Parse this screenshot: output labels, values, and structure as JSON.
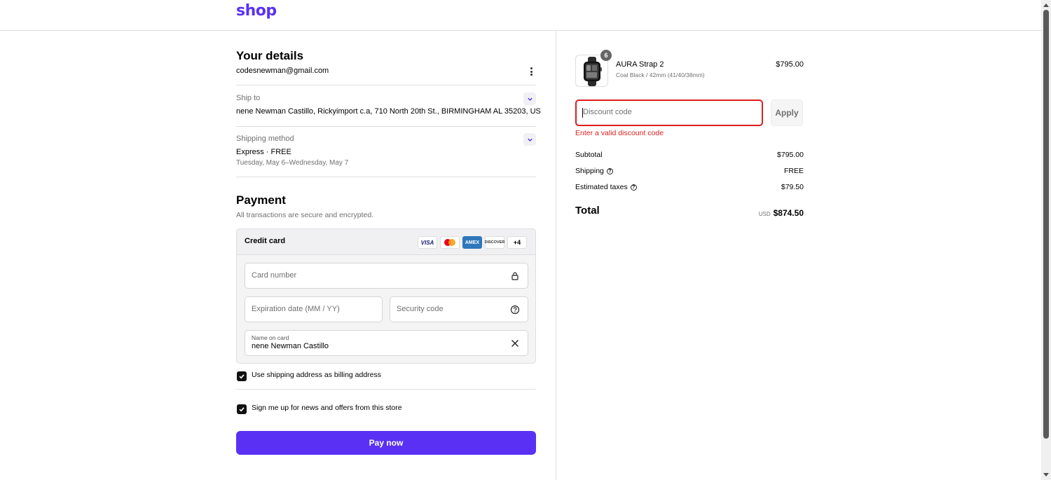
{
  "brand": {
    "logo_text": "shop",
    "accent_color": "#5a31f4"
  },
  "details": {
    "title": "Your details",
    "email": "codesnewman@gmail.com",
    "ship_to_label": "Ship to",
    "ship_to_value": "nene Newman Castillo, Rickyimport c.a, 710 North 20th St., BIRMINGHAM AL 35203, US",
    "shipping_method_label": "Shipping method",
    "shipping_method_value": "Express · FREE",
    "shipping_dates": "Tuesday, May 6–Wednesday, May 7"
  },
  "payment": {
    "title": "Payment",
    "subtitle": "All transactions are secure and encrypted.",
    "method_label": "Credit card",
    "card_brands": [
      "VISA",
      "mastercard",
      "AMEX",
      "DISCOVER"
    ],
    "more_brands": "+4",
    "card_number_placeholder": "Card number",
    "expiration_placeholder": "Expiration date (MM / YY)",
    "security_code_placeholder": "Security code",
    "name_on_card_label": "Name on card",
    "name_on_card_value": "nene Newman Castillo",
    "billing_checkbox_label": "Use shipping address as billing address",
    "newsletter_checkbox_label": "Sign me up for news and offers from this store",
    "pay_button": "Pay now"
  },
  "order": {
    "product_name": "AURA Strap 2",
    "product_variant": "Coal Black / 42mm (41/40/38mm)",
    "product_price": "$795.00",
    "quantity_badge": "6",
    "discount_placeholder": "Discount code",
    "apply_button": "Apply",
    "discount_error": "Enter a valid discount code",
    "error_color": "#dd1d1d",
    "subtotal_label": "Subtotal",
    "subtotal_value": "$795.00",
    "shipping_label": "Shipping",
    "shipping_value": "FREE",
    "taxes_label": "Estimated taxes",
    "taxes_value": "$79.50",
    "total_label": "Total",
    "total_currency": "USD",
    "total_value": "$874.50"
  }
}
